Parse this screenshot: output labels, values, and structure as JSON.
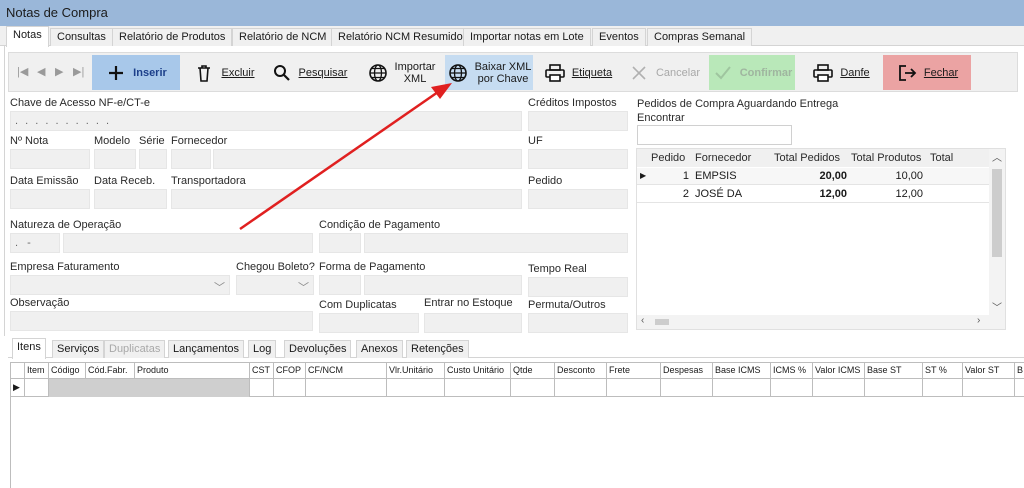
{
  "window": {
    "title": "Notas de Compra"
  },
  "top_tabs": [
    "Notas",
    "Consultas",
    "Relatório de Produtos",
    "Relatório de NCM",
    "Relatório NCM Resumido",
    "Importar notas em Lote",
    "Eventos",
    "Compras Semanal"
  ],
  "toolbar": {
    "inserir": "Inserir",
    "excluir": "Excluir",
    "pesquisar": "Pesquisar",
    "importar_1": "Importar",
    "importar_2": "XML",
    "baixar_1": "Baixar XML",
    "baixar_2": "por Chave",
    "etiqueta": "Etiqueta",
    "cancelar": "Cancelar",
    "confirmar": "Confirmar",
    "danfe": "Danfe",
    "fechar": "Fechar"
  },
  "form": {
    "chave_label": "Chave de Acesso NF-e/CT-e",
    "chave_value": ". . . . . . . . . .",
    "creditos_label": "Créditos Impostos",
    "nota_label": "Nº Nota",
    "modelo_label": "Modelo",
    "serie_label": "Série",
    "fornecedor_label": "Fornecedor",
    "uf_label": "UF",
    "emissao_label": "Data Emissão",
    "receb_label": "Data Receb.",
    "transportadora_label": "Transportadora",
    "pedido_label": "Pedido",
    "natureza_label": "Natureza de Operação",
    "natureza_value": ". -",
    "condicao_label": "Condição de Pagamento",
    "empresa_label": "Empresa Faturamento",
    "boleto_label": "Chegou Boleto?",
    "forma_label": "Forma de Pagamento",
    "tempo_label": "Tempo Real",
    "obs_label": "Observação",
    "duplicatas_label": "Com Duplicatas",
    "estoque_label": "Entrar no Estoque",
    "permuta_label": "Permuta/Outros"
  },
  "orders": {
    "title": "Pedidos de Compra Aguardando Entrega",
    "find_label": "Encontrar",
    "columns": [
      "Pedido",
      "Fornecedor",
      "Total Pedidos",
      "Total Produtos",
      "Total"
    ],
    "rows": [
      {
        "pedido": "1",
        "fornecedor": "EMPSIS",
        "total_pedidos": "20,00",
        "total_produtos": "10,00"
      },
      {
        "pedido": "2",
        "fornecedor": "JOSÉ DA",
        "total_pedidos": "12,00",
        "total_produtos": "12,00"
      }
    ]
  },
  "bottom_tabs": [
    "Itens",
    "Serviços",
    "Duplicatas",
    "Lançamentos",
    "Log",
    "Devoluções",
    "Anexos",
    "Retenções"
  ],
  "items_columns": [
    "Item",
    "Código",
    "Cód.Fabr.",
    "Produto",
    "CST",
    "CFOP",
    "CF/NCM",
    "Vlr.Unitário",
    "Custo Unitário",
    "Qtde",
    "Desconto",
    "Frete",
    "Despesas",
    "Base ICMS",
    "ICMS %",
    "Valor ICMS",
    "Base ST",
    "ST %",
    "Valor ST",
    "B"
  ],
  "colors": {
    "titlebar": "#9ab7d9",
    "insert_btn": "#a8c8ea",
    "confirm_btn": "#b9e8b9",
    "close_btn": "#eba3a3",
    "annotation_arrow": "#e02020"
  }
}
